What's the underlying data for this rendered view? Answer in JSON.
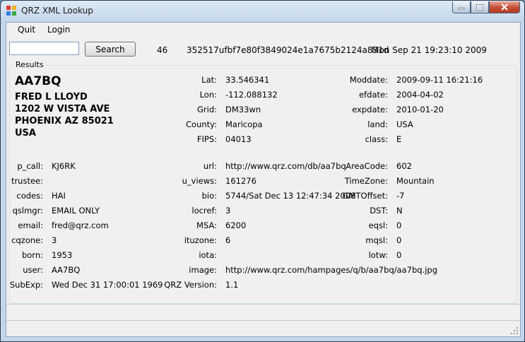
{
  "window": {
    "title": "QRZ XML Lookup"
  },
  "menu": {
    "quit": "Quit",
    "login": "Login"
  },
  "search": {
    "button_label": "Search",
    "value": ""
  },
  "topinfo": {
    "count": "46",
    "key": "352517ufbf7e80f3849024e1a7675b2124a831d",
    "timestamp": "Mon Sep 21 19:23:10 2009"
  },
  "results": {
    "group_label": "Results",
    "callsign": "AA7BQ",
    "name": "FRED L LLOYD",
    "address1": "1202 W VISTA AVE",
    "address2": "PHOENIX AZ 85021",
    "country": "USA",
    "mid_top": [
      {
        "label": "Lat:",
        "value": "33.546341"
      },
      {
        "label": "Lon:",
        "value": "-112.088132"
      },
      {
        "label": "Grid:",
        "value": "DM33wn"
      },
      {
        "label": "County:",
        "value": "Maricopa"
      },
      {
        "label": "FIPS:",
        "value": "04013"
      }
    ],
    "right_top": [
      {
        "label": "Moddate:",
        "value": "2009-09-11 16:21:16"
      },
      {
        "label": "efdate:",
        "value": "2004-04-02"
      },
      {
        "label": "expdate:",
        "value": "2010-01-20"
      },
      {
        "label": "land:",
        "value": "USA"
      },
      {
        "label": "class:",
        "value": "E"
      }
    ],
    "left_bottom": [
      {
        "label": "p_call:",
        "value": "KJ6RK"
      },
      {
        "label": "trustee:",
        "value": ""
      },
      {
        "label": "codes:",
        "value": "HAI"
      },
      {
        "label": "qslmgr:",
        "value": "EMAIL ONLY"
      },
      {
        "label": "email:",
        "value": "fred@qrz.com"
      },
      {
        "label": "cqzone:",
        "value": "3"
      },
      {
        "label": "born:",
        "value": "1953"
      },
      {
        "label": "user:",
        "value": "AA7BQ"
      },
      {
        "label": "SubExp:",
        "value": "Wed Dec 31 17:00:01 1969"
      }
    ],
    "mid_bottom": [
      {
        "label": "url:",
        "value": "http://www.qrz.com/db/aa7bq"
      },
      {
        "label": "u_views:",
        "value": "161276"
      },
      {
        "label": "bio:",
        "value": "5744/Sat Dec 13 12:47:34 2008"
      },
      {
        "label": "locref:",
        "value": "3"
      },
      {
        "label": "MSA:",
        "value": "6200"
      },
      {
        "label": "ituzone:",
        "value": "6"
      },
      {
        "label": "iota:",
        "value": ""
      },
      {
        "label": "image:",
        "value": "http://www.qrz.com/hampages/q/b/aa7bq/aa7bq.jpg"
      },
      {
        "label": "QRZ Version:",
        "value": "1.1"
      }
    ],
    "right_bottom": [
      {
        "label": "AreaCode:",
        "value": "602"
      },
      {
        "label": "TimeZone:",
        "value": "Mountain"
      },
      {
        "label": "GMTOffset:",
        "value": "-7"
      },
      {
        "label": "DST:",
        "value": "N"
      },
      {
        "label": "eqsl:",
        "value": "0"
      },
      {
        "label": "mqsl:",
        "value": "0"
      },
      {
        "label": "lotw:",
        "value": "0"
      }
    ]
  }
}
